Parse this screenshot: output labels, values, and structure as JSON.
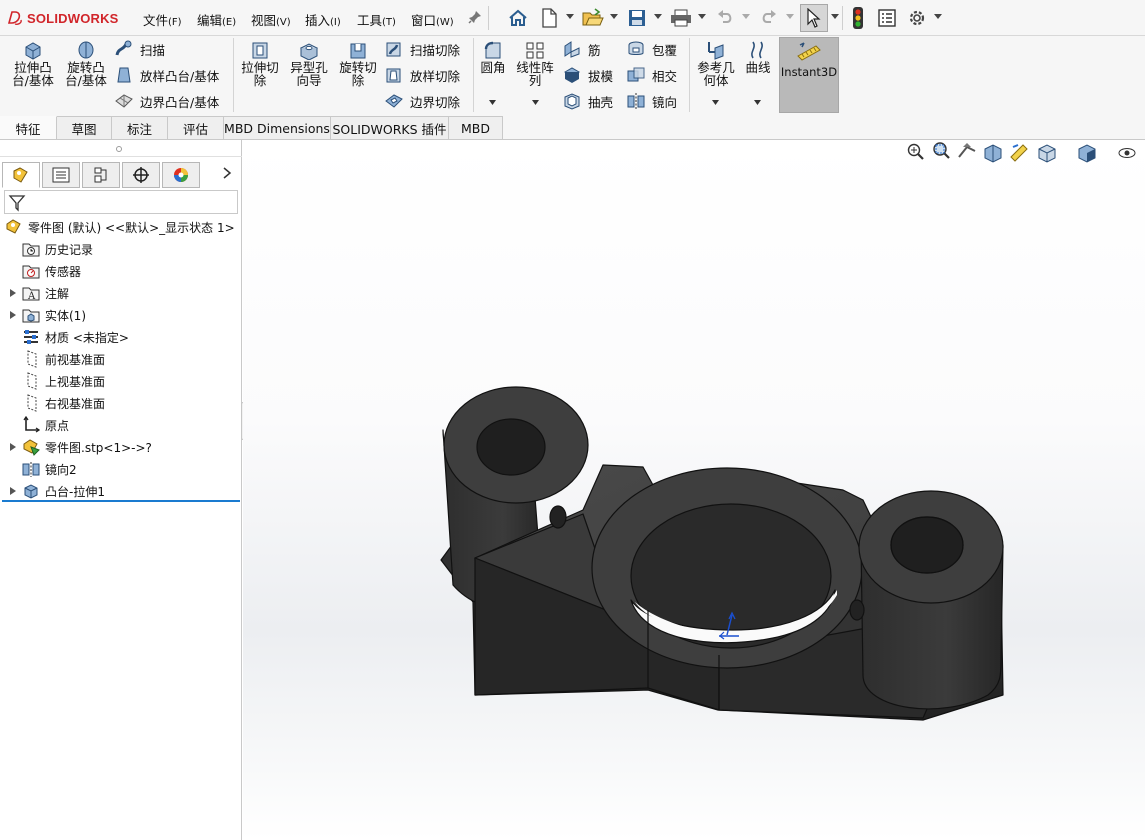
{
  "app": {
    "brand": "SOLIDWORKS",
    "brand_color": "#d1252a",
    "accent_color": "#1a7bd0"
  },
  "menu": {
    "items": [
      {
        "label": "文件",
        "key": "(F)"
      },
      {
        "label": "编辑",
        "key": "(E)"
      },
      {
        "label": "视图",
        "key": "(V)"
      },
      {
        "label": "插入",
        "key": "(I)"
      },
      {
        "label": "工具",
        "key": "(T)"
      },
      {
        "label": "窗口",
        "key": "(W)"
      }
    ]
  },
  "quick_access": {
    "icons": [
      "home-icon",
      "new-document-icon",
      "open-folder-icon",
      "save-icon",
      "print-icon",
      "undo-icon",
      "redo-icon",
      "select-arrow-icon",
      "rebuild-traffic-light-icon",
      "file-properties-icon",
      "options-gear-icon"
    ]
  },
  "ribbon": {
    "extrude_boss": "拉伸凸\n台/基体",
    "revolve_boss": "旋转凸\n台/基体",
    "sweep": "扫描",
    "loft_boss": "放样凸台/基体",
    "boundary_boss": "边界凸台/基体",
    "extrude_cut": "拉伸切\n除",
    "hole_wizard": "异型孔\n向导",
    "revolve_cut": "旋转切\n除",
    "swept_cut": "扫描切除",
    "lofted_cut": "放样切除",
    "boundary_cut": "边界切除",
    "fillet": "圆角",
    "linear_pattern": "线性阵\n列",
    "rib": "筋",
    "draft": "拔模",
    "shell": "抽壳",
    "wrap": "包覆",
    "intersect": "相交",
    "mirror": "镜向",
    "reference_geometry": "参考几\n何体",
    "curves": "曲线",
    "instant3d": "Instant3D"
  },
  "command_tabs": [
    "特征",
    "草图",
    "标注",
    "评估",
    "MBD Dimensions",
    "SOLIDWORKS 插件",
    "MBD"
  ],
  "feature_tree": {
    "root": "零件图 (默认) <<默认>_显示状态 1>",
    "items": [
      {
        "label": "历史记录",
        "icon": "history-folder-icon",
        "expandable": false
      },
      {
        "label": "传感器",
        "icon": "sensors-folder-icon",
        "expandable": false
      },
      {
        "label": "注解",
        "icon": "annotations-icon",
        "expandable": true
      },
      {
        "label": "实体(1)",
        "icon": "solid-bodies-icon",
        "expandable": true
      },
      {
        "label": "材质 <未指定>",
        "icon": "material-icon",
        "expandable": false
      },
      {
        "label": "前视基准面",
        "icon": "plane-icon",
        "expandable": false
      },
      {
        "label": "上视基准面",
        "icon": "plane-icon",
        "expandable": false
      },
      {
        "label": "右视基准面",
        "icon": "plane-icon",
        "expandable": false
      },
      {
        "label": "原点",
        "icon": "origin-icon",
        "expandable": false
      },
      {
        "label": "零件图.stp<1>->?",
        "icon": "imported-part-icon",
        "expandable": true
      },
      {
        "label": "镜向2",
        "icon": "mirror-feature-icon",
        "expandable": false
      },
      {
        "label": "凸台-拉伸1",
        "icon": "boss-extrude-icon",
        "expandable": true
      }
    ]
  },
  "viewport": {
    "model_color": "#3a3a3a",
    "heads_up_icons": [
      "zoom-to-fit-icon",
      "zoom-area-icon",
      "previous-view-icon",
      "section-view-icon",
      "dynamic-annotation-icon",
      "view-orientation-icon",
      "display-style-icon",
      "hide-show-items-icon"
    ]
  }
}
